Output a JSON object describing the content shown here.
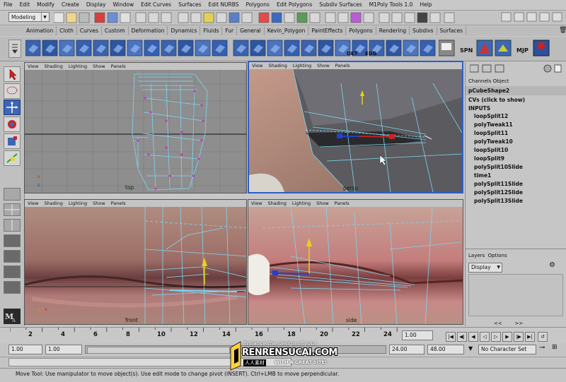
{
  "menu": [
    "File",
    "Edit",
    "Modify",
    "Create",
    "Display",
    "Window",
    "Edit Curves",
    "Surfaces",
    "Edit NURBS",
    "Polygons",
    "Edit Polygons",
    "Subdiv Surfaces",
    "M1Poly Tools 1.0",
    "Help"
  ],
  "status_line": {
    "mode_select": "Modeling"
  },
  "shelf_tabs": [
    "Animation",
    "Cloth",
    "Curves",
    "Custom",
    "Deformation",
    "Dynamics",
    "Fluids",
    "Fur",
    "General",
    "Kevin_Polygon",
    "PaintEffects",
    "Polygons",
    "Rendering",
    "Subdivs",
    "Surfaces"
  ],
  "shelf_labels": [
    "DET",
    "EDG",
    "SPN",
    "MJP"
  ],
  "viewports": {
    "panel_menu": [
      "View",
      "Shading",
      "Lighting",
      "Show",
      "Panels"
    ],
    "labels": [
      "top",
      "persp",
      "front",
      "side"
    ],
    "axis_letters": {
      "x": "x",
      "y": "y",
      "z": "z"
    }
  },
  "channel_box": {
    "tabs": [
      "Channels",
      "Object"
    ],
    "node": "pCubeShape2",
    "cvs": "CVs (click to show)",
    "inputs_header": "INPUTS",
    "inputs": [
      "loopSplit12",
      "polyTweak11",
      "loopSplit11",
      "polyTweak10",
      "loopSplit10",
      "loopSplit9",
      "polySplit10Slide",
      "time1",
      "polySplit11Slide",
      "polySplit12Slide",
      "polySplit13Slide"
    ],
    "layers_menu": [
      "Layers",
      "Options"
    ],
    "layer_type": "Display"
  },
  "timeline": {
    "ticks": [
      "2",
      "4",
      "6",
      "8",
      "10",
      "12",
      "14",
      "16",
      "18",
      "20",
      "22",
      "24"
    ],
    "current_frame": "1.00"
  },
  "range": {
    "start": "1.00",
    "start_inner": "1.00",
    "end_inner": "24.00",
    "end": "48.00",
    "character_set": "No Character Set"
  },
  "help_line": "Move Tool: Use manipulator to move object(s). Use edit mode to change pivot (INSERT). Ctrl+LMB to move perpendicular.",
  "watermark": {
    "line1": "Enhance the design of your",
    "site": "RENRENSUCAI.COM",
    "tag": "WITH A GREAT SITE!",
    "cn": "人人素材"
  },
  "colors": {
    "wire": "#7fd6f2",
    "vertex": "#c73ac0",
    "active_border": "#2b5ec9",
    "manip_y": "#e8d21a",
    "manip_x": "#cc2020",
    "manip_z": "#2040d0"
  }
}
